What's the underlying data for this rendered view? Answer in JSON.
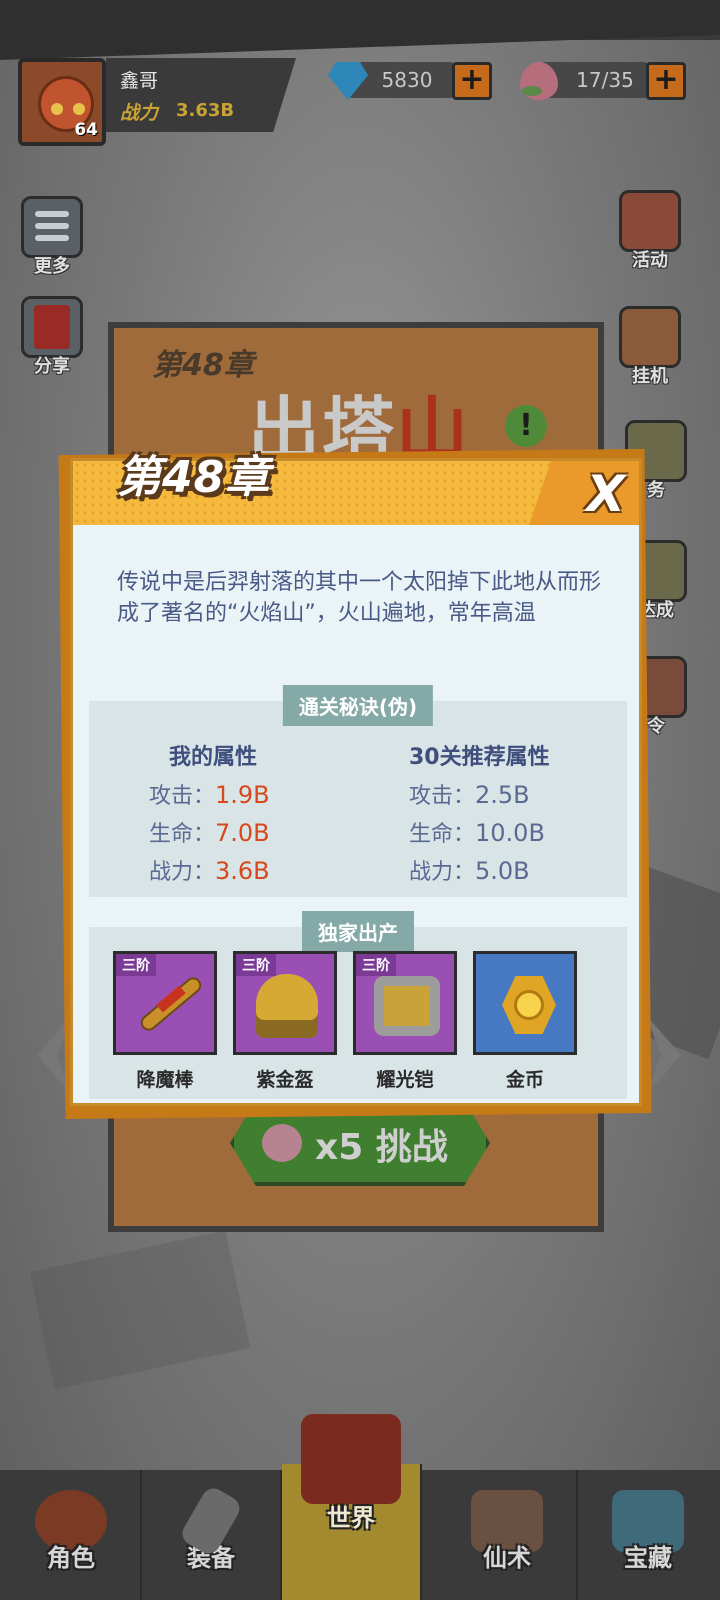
{
  "player": {
    "name": "鑫哥",
    "level": "64",
    "power_label": "战力",
    "power_value": "3.63B"
  },
  "resources": {
    "gems": "5830",
    "stamina": "17/35",
    "plus": "+"
  },
  "side_left": [
    {
      "label": "更多",
      "icon": "menu-list-icon"
    },
    {
      "label": "分享",
      "icon": "red-envelope-icon"
    }
  ],
  "side_right": [
    {
      "label": "活动",
      "icon": "drum-icon"
    },
    {
      "label": "挂机",
      "icon": "idle-chest-icon"
    },
    {
      "label": "任务",
      "visible": "务",
      "icon": "task-icon"
    },
    {
      "label": "达成",
      "icon": "achievement-icon"
    },
    {
      "label": "令",
      "icon": "battle-pass-icon"
    }
  ],
  "stage": {
    "chapter": "第48章",
    "title_main": "出塔",
    "title_red": "山",
    "warning": "!",
    "challenge_cost": "x5",
    "challenge_label": "挑战"
  },
  "dialog": {
    "title": "第48章",
    "close": "X",
    "description": "传说中是后羿射落的其中一个太阳掉下此地从而形成了著名的“火焰山”，火山遍地，常年高温",
    "tips_tag": "通关秘诀(伪)",
    "my_stats": {
      "heading": "我的属性",
      "rows": [
        {
          "label": "攻击：",
          "value": "1.9B"
        },
        {
          "label": "生命：",
          "value": "7.0B"
        },
        {
          "label": "战力：",
          "value": "3.6B"
        }
      ]
    },
    "recommended_stats": {
      "heading": "30关推荐属性",
      "rows": [
        {
          "label": "攻击：",
          "value": "2.5B"
        },
        {
          "label": "生命：",
          "value": "10.0B"
        },
        {
          "label": "战力：",
          "value": "5.0B"
        }
      ]
    },
    "drops_tag": "独家出产",
    "drops": [
      {
        "name": "降魔棒",
        "tier": "三阶",
        "icon": "staff-icon"
      },
      {
        "name": "紫金盔",
        "tier": "三阶",
        "icon": "helmet-icon"
      },
      {
        "name": "耀光铠",
        "tier": "三阶",
        "icon": "armor-icon"
      },
      {
        "name": "金币",
        "tier": "",
        "icon": "gold-coin-icon"
      }
    ]
  },
  "nav": [
    {
      "label": "角色",
      "icon": "monkey-king-icon"
    },
    {
      "label": "装备",
      "icon": "sword-icon"
    },
    {
      "label": "世界",
      "icon": "pagoda-gate-icon",
      "active": true
    },
    {
      "label": "仙术",
      "icon": "cauldron-icon"
    },
    {
      "label": "宝藏",
      "icon": "treasure-chest-icon"
    }
  ]
}
